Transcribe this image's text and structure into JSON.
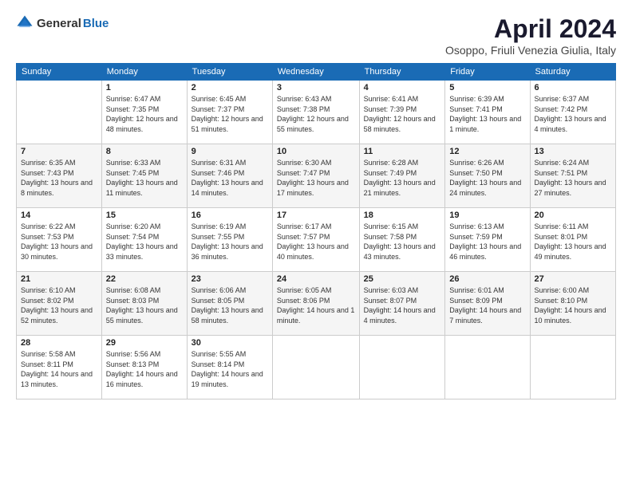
{
  "header": {
    "logo_general": "General",
    "logo_blue": "Blue",
    "month_title": "April 2024",
    "location": "Osoppo, Friuli Venezia Giulia, Italy"
  },
  "columns": [
    "Sunday",
    "Monday",
    "Tuesday",
    "Wednesday",
    "Thursday",
    "Friday",
    "Saturday"
  ],
  "weeks": [
    [
      {
        "day": "",
        "sunrise": "",
        "sunset": "",
        "daylight": ""
      },
      {
        "day": "1",
        "sunrise": "Sunrise: 6:47 AM",
        "sunset": "Sunset: 7:35 PM",
        "daylight": "Daylight: 12 hours and 48 minutes."
      },
      {
        "day": "2",
        "sunrise": "Sunrise: 6:45 AM",
        "sunset": "Sunset: 7:37 PM",
        "daylight": "Daylight: 12 hours and 51 minutes."
      },
      {
        "day": "3",
        "sunrise": "Sunrise: 6:43 AM",
        "sunset": "Sunset: 7:38 PM",
        "daylight": "Daylight: 12 hours and 55 minutes."
      },
      {
        "day": "4",
        "sunrise": "Sunrise: 6:41 AM",
        "sunset": "Sunset: 7:39 PM",
        "daylight": "Daylight: 12 hours and 58 minutes."
      },
      {
        "day": "5",
        "sunrise": "Sunrise: 6:39 AM",
        "sunset": "Sunset: 7:41 PM",
        "daylight": "Daylight: 13 hours and 1 minute."
      },
      {
        "day": "6",
        "sunrise": "Sunrise: 6:37 AM",
        "sunset": "Sunset: 7:42 PM",
        "daylight": "Daylight: 13 hours and 4 minutes."
      }
    ],
    [
      {
        "day": "7",
        "sunrise": "Sunrise: 6:35 AM",
        "sunset": "Sunset: 7:43 PM",
        "daylight": "Daylight: 13 hours and 8 minutes."
      },
      {
        "day": "8",
        "sunrise": "Sunrise: 6:33 AM",
        "sunset": "Sunset: 7:45 PM",
        "daylight": "Daylight: 13 hours and 11 minutes."
      },
      {
        "day": "9",
        "sunrise": "Sunrise: 6:31 AM",
        "sunset": "Sunset: 7:46 PM",
        "daylight": "Daylight: 13 hours and 14 minutes."
      },
      {
        "day": "10",
        "sunrise": "Sunrise: 6:30 AM",
        "sunset": "Sunset: 7:47 PM",
        "daylight": "Daylight: 13 hours and 17 minutes."
      },
      {
        "day": "11",
        "sunrise": "Sunrise: 6:28 AM",
        "sunset": "Sunset: 7:49 PM",
        "daylight": "Daylight: 13 hours and 21 minutes."
      },
      {
        "day": "12",
        "sunrise": "Sunrise: 6:26 AM",
        "sunset": "Sunset: 7:50 PM",
        "daylight": "Daylight: 13 hours and 24 minutes."
      },
      {
        "day": "13",
        "sunrise": "Sunrise: 6:24 AM",
        "sunset": "Sunset: 7:51 PM",
        "daylight": "Daylight: 13 hours and 27 minutes."
      }
    ],
    [
      {
        "day": "14",
        "sunrise": "Sunrise: 6:22 AM",
        "sunset": "Sunset: 7:53 PM",
        "daylight": "Daylight: 13 hours and 30 minutes."
      },
      {
        "day": "15",
        "sunrise": "Sunrise: 6:20 AM",
        "sunset": "Sunset: 7:54 PM",
        "daylight": "Daylight: 13 hours and 33 minutes."
      },
      {
        "day": "16",
        "sunrise": "Sunrise: 6:19 AM",
        "sunset": "Sunset: 7:55 PM",
        "daylight": "Daylight: 13 hours and 36 minutes."
      },
      {
        "day": "17",
        "sunrise": "Sunrise: 6:17 AM",
        "sunset": "Sunset: 7:57 PM",
        "daylight": "Daylight: 13 hours and 40 minutes."
      },
      {
        "day": "18",
        "sunrise": "Sunrise: 6:15 AM",
        "sunset": "Sunset: 7:58 PM",
        "daylight": "Daylight: 13 hours and 43 minutes."
      },
      {
        "day": "19",
        "sunrise": "Sunrise: 6:13 AM",
        "sunset": "Sunset: 7:59 PM",
        "daylight": "Daylight: 13 hours and 46 minutes."
      },
      {
        "day": "20",
        "sunrise": "Sunrise: 6:11 AM",
        "sunset": "Sunset: 8:01 PM",
        "daylight": "Daylight: 13 hours and 49 minutes."
      }
    ],
    [
      {
        "day": "21",
        "sunrise": "Sunrise: 6:10 AM",
        "sunset": "Sunset: 8:02 PM",
        "daylight": "Daylight: 13 hours and 52 minutes."
      },
      {
        "day": "22",
        "sunrise": "Sunrise: 6:08 AM",
        "sunset": "Sunset: 8:03 PM",
        "daylight": "Daylight: 13 hours and 55 minutes."
      },
      {
        "day": "23",
        "sunrise": "Sunrise: 6:06 AM",
        "sunset": "Sunset: 8:05 PM",
        "daylight": "Daylight: 13 hours and 58 minutes."
      },
      {
        "day": "24",
        "sunrise": "Sunrise: 6:05 AM",
        "sunset": "Sunset: 8:06 PM",
        "daylight": "Daylight: 14 hours and 1 minute."
      },
      {
        "day": "25",
        "sunrise": "Sunrise: 6:03 AM",
        "sunset": "Sunset: 8:07 PM",
        "daylight": "Daylight: 14 hours and 4 minutes."
      },
      {
        "day": "26",
        "sunrise": "Sunrise: 6:01 AM",
        "sunset": "Sunset: 8:09 PM",
        "daylight": "Daylight: 14 hours and 7 minutes."
      },
      {
        "day": "27",
        "sunrise": "Sunrise: 6:00 AM",
        "sunset": "Sunset: 8:10 PM",
        "daylight": "Daylight: 14 hours and 10 minutes."
      }
    ],
    [
      {
        "day": "28",
        "sunrise": "Sunrise: 5:58 AM",
        "sunset": "Sunset: 8:11 PM",
        "daylight": "Daylight: 14 hours and 13 minutes."
      },
      {
        "day": "29",
        "sunrise": "Sunrise: 5:56 AM",
        "sunset": "Sunset: 8:13 PM",
        "daylight": "Daylight: 14 hours and 16 minutes."
      },
      {
        "day": "30",
        "sunrise": "Sunrise: 5:55 AM",
        "sunset": "Sunset: 8:14 PM",
        "daylight": "Daylight: 14 hours and 19 minutes."
      },
      {
        "day": "",
        "sunrise": "",
        "sunset": "",
        "daylight": ""
      },
      {
        "day": "",
        "sunrise": "",
        "sunset": "",
        "daylight": ""
      },
      {
        "day": "",
        "sunrise": "",
        "sunset": "",
        "daylight": ""
      },
      {
        "day": "",
        "sunrise": "",
        "sunset": "",
        "daylight": ""
      }
    ]
  ]
}
